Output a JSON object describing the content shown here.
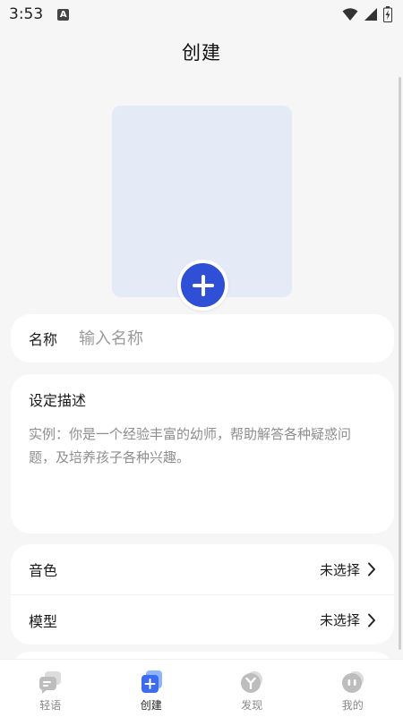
{
  "status_bar": {
    "time": "3:53",
    "notification_badge": "A"
  },
  "header": {
    "title": "创建"
  },
  "name_field": {
    "label": "名称",
    "placeholder": "输入名称",
    "value": ""
  },
  "description": {
    "label": "设定描述",
    "placeholder": "实例：你是一个经验丰富的幼师，帮助解答各种疑惑问题，及培养孩子各种兴趣。",
    "value": ""
  },
  "settings": [
    {
      "label": "音色",
      "value": "未选择"
    },
    {
      "label": "模型",
      "value": "未选择"
    }
  ],
  "bottom_nav": [
    {
      "label": "轻语",
      "icon": "chat-icon",
      "active": false
    },
    {
      "label": "创建",
      "icon": "create-icon",
      "active": true
    },
    {
      "label": "发现",
      "icon": "discover-icon",
      "active": false
    },
    {
      "label": "我的",
      "icon": "profile-icon",
      "active": false
    }
  ],
  "colors": {
    "accent": "#2f4fd6",
    "avatar_bg": "#e4ebf6",
    "page_bg": "#f6f6f7"
  }
}
